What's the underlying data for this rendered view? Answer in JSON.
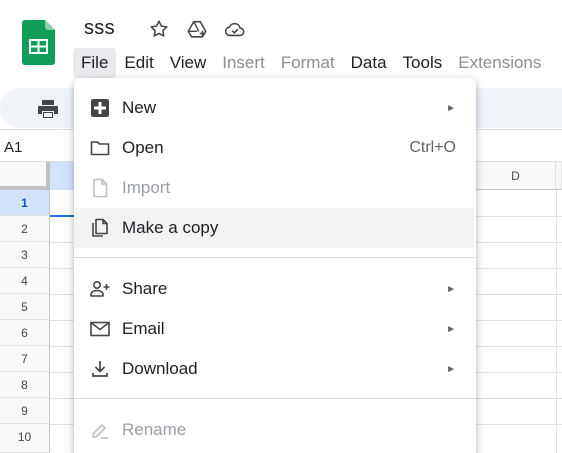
{
  "app": {
    "title": "sss",
    "brand_color": "#0f9d58"
  },
  "menubar": {
    "items": [
      {
        "label": "File",
        "active": true
      },
      {
        "label": "Edit"
      },
      {
        "label": "View"
      },
      {
        "label": "Insert",
        "disabled": true
      },
      {
        "label": "Format",
        "disabled": true
      },
      {
        "label": "Data"
      },
      {
        "label": "Tools"
      },
      {
        "label": "Extensions",
        "disabled": true
      }
    ]
  },
  "title_icons": [
    "star-icon",
    "move-to-drive-icon",
    "cloud-saved-icon"
  ],
  "toolbar": {
    "print_icon": "print-icon"
  },
  "namebox": {
    "value": "A1"
  },
  "grid": {
    "column_headers": [
      "D"
    ],
    "row_headers": [
      "1",
      "2",
      "3",
      "4",
      "5",
      "6",
      "7",
      "8",
      "9",
      "10"
    ],
    "selected_row": "1"
  },
  "file_menu": {
    "items": [
      {
        "label": "New",
        "icon": "new-sheet-icon",
        "submenu": true,
        "arrow": "►"
      },
      {
        "label": "Open",
        "icon": "folder-icon",
        "shortcut": "Ctrl+O"
      },
      {
        "label": "Import",
        "icon": "file-icon",
        "disabled": true
      },
      {
        "label": "Make a copy",
        "icon": "copy-icon",
        "highlighted": true
      },
      {
        "label": "Share",
        "icon": "person-add-icon",
        "submenu": true,
        "arrow": "►"
      },
      {
        "label": "Email",
        "icon": "mail-icon",
        "submenu": true,
        "arrow": "►"
      },
      {
        "label": "Download",
        "icon": "download-icon",
        "submenu": true,
        "arrow": "►"
      },
      {
        "label": "Rename",
        "icon": "pencil-icon",
        "disabled": true
      }
    ]
  }
}
